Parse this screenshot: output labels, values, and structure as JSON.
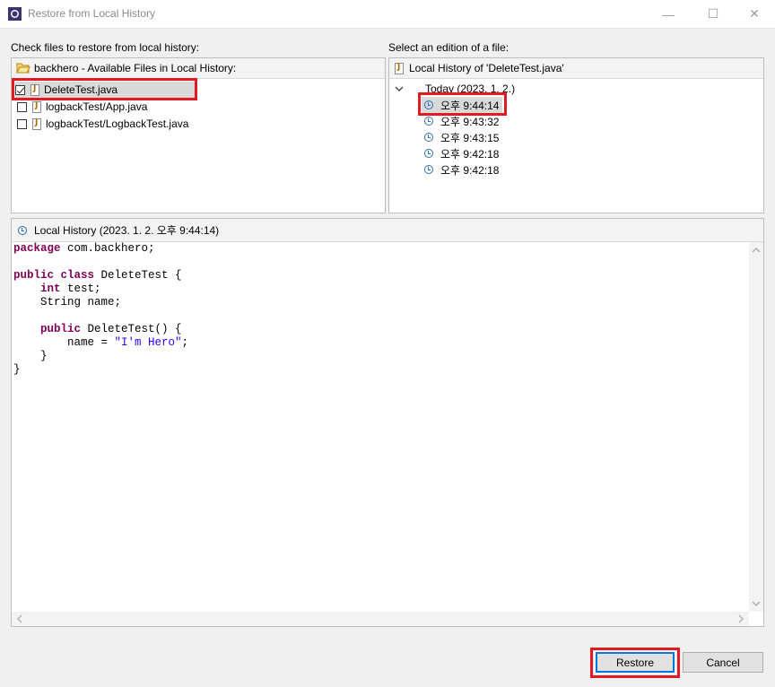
{
  "window": {
    "title": "Restore from Local History",
    "minimize_glyph": "—",
    "maximize_glyph": "☐",
    "close_glyph": "✕"
  },
  "left": {
    "label": "Check files to restore from local history:",
    "header": "backhero - Available Files in Local History:",
    "files": [
      {
        "name": "DeleteTest.java",
        "checked": true
      },
      {
        "name": "logbackTest/App.java",
        "checked": false
      },
      {
        "name": "logbackTest/LogbackTest.java",
        "checked": false
      }
    ]
  },
  "right": {
    "label": "Select an edition of a file:",
    "header": "Local History of 'DeleteTest.java'",
    "group": "Today (2023. 1. 2.)",
    "editions": [
      "오후 9:44:14",
      "오후 9:43:32",
      "오후 9:43:15",
      "오후 9:42:18",
      "오후 9:42:18"
    ]
  },
  "preview": {
    "header": "Local History (2023. 1. 2. 오후 9:44:14)",
    "code": {
      "l1_kw": "package",
      "l1_rest": " com.backhero;",
      "l3_kw1": "public",
      "l3_kw2": "class",
      "l3_rest": " DeleteTest {",
      "l4_kw": "int",
      "l4_rest": " test;",
      "l5": "    String name;",
      "l7_kw": "public",
      "l7_rest": " DeleteTest() {",
      "l8_pre": "        name = ",
      "l8_str": "\"I'm Hero\"",
      "l8_post": ";",
      "l9": "    }",
      "l10": "}"
    }
  },
  "buttons": {
    "restore": "Restore",
    "cancel": "Cancel"
  },
  "colors": {
    "highlight": "#e01b24",
    "keyword": "#7f0055",
    "string": "#2a00ff",
    "clock": "#2d6fb0"
  }
}
